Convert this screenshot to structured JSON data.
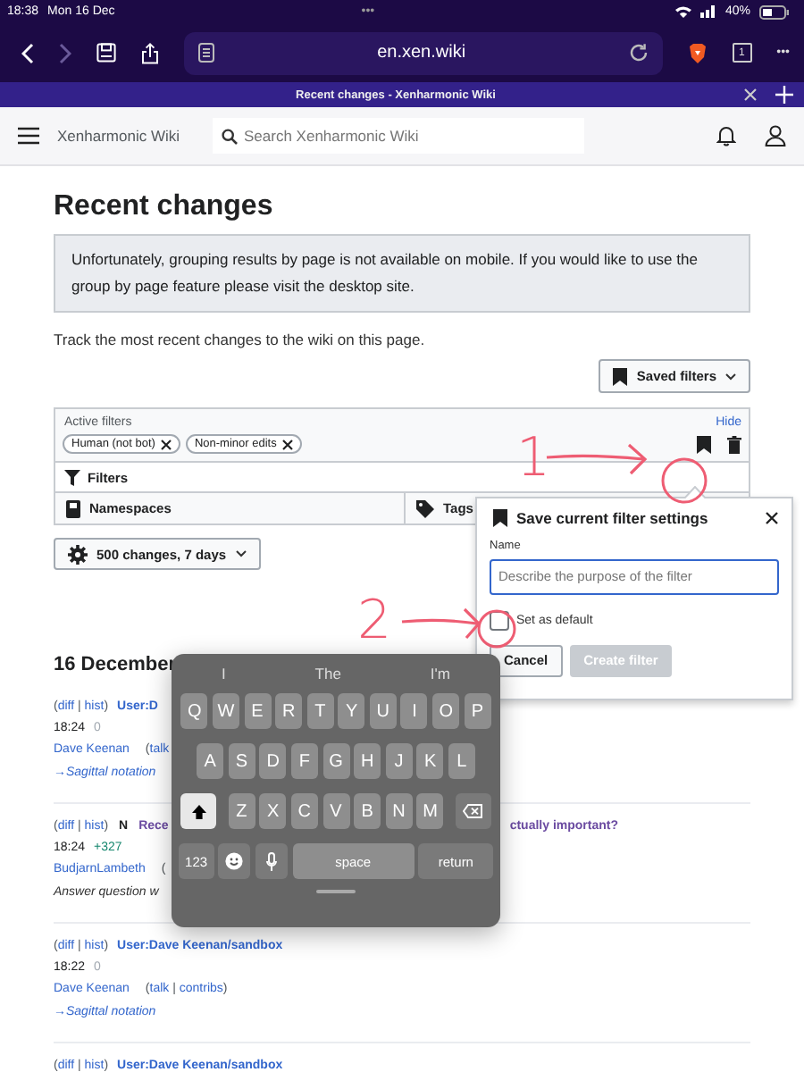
{
  "status_bar": {
    "time": "18:38",
    "date": "Mon 16 Dec",
    "dots": "•••",
    "battery": "40%"
  },
  "browser": {
    "url": "en.xen.wiki",
    "tab_count": "1",
    "more": "•••",
    "tab_title": "Recent changes - Xenharmonic Wiki"
  },
  "wiki_header": {
    "site_name": "Xenharmonic Wiki",
    "search": {
      "placeholder": "Search Xenharmonic Wiki"
    }
  },
  "page": {
    "title": "Recent changes",
    "notice": "Unfortunately, grouping results by page is not available on mobile. If you would like to use the group by page feature please visit the desktop site.",
    "intro": "Track the most recent changes to the wiki on this page.",
    "saved_filters": "Saved filters"
  },
  "active_filters": {
    "label": "Active filters",
    "hide": "Hide",
    "tags": [
      {
        "label": "Human (not bot)"
      },
      {
        "label": "Non-minor edits"
      }
    ]
  },
  "filters": {
    "label": "Filters",
    "menus": [
      {
        "label": "Namespaces",
        "kind": "namespaces"
      },
      {
        "label": "Tags",
        "kind": "tags"
      }
    ]
  },
  "limit_button": "500 changes, 7 days",
  "save_dialog": {
    "title": "Save current filter settings",
    "name_label": "Name",
    "placeholder": "Describe the purpose of the filter",
    "default_label": "Set as default",
    "default_checked": false,
    "cancel": "Cancel",
    "create": "Create filter",
    "create_disabled": true
  },
  "changes": {
    "date": "16 December",
    "entries": [
      {
        "history": [
          {
            "text": "(",
            "kind": "text"
          },
          {
            "text": "diff",
            "kind": "link"
          },
          {
            "text": " | ",
            "kind": "text"
          },
          {
            "text": "hist",
            "kind": "link"
          },
          {
            "text": ")",
            "kind": "text"
          }
        ],
        "title": "User:D",
        "visited": false,
        "time": "18:24",
        "size": {
          "text": "0",
          "kind": "neutral"
        },
        "user": "Dave Keenan",
        "tools": [
          {
            "text": "(",
            "kind": "text"
          },
          {
            "text": "talk",
            "kind": "link"
          }
        ],
        "summary": {
          "text": "→Sagittal notation",
          "kind": "section"
        }
      },
      {
        "history": [
          {
            "text": "(",
            "kind": "text"
          },
          {
            "text": "diff",
            "kind": "link"
          },
          {
            "text": " | ",
            "kind": "text"
          },
          {
            "text": "hist",
            "kind": "link"
          },
          {
            "text": ")",
            "kind": "text"
          }
        ],
        "new_flag": "N",
        "title": "Rece",
        "title_rest": "ctually important?",
        "visited": true,
        "time": "18:24",
        "size": {
          "text": "+327",
          "kind": "positive"
        },
        "user": "BudjarnLambeth",
        "tools": [
          {
            "text": "(",
            "kind": "text"
          }
        ],
        "summary": {
          "text": "Answer question w",
          "kind": "comment"
        }
      },
      {
        "history": [
          {
            "text": "(",
            "kind": "text"
          },
          {
            "text": "diff",
            "kind": "link"
          },
          {
            "text": " | ",
            "kind": "text"
          },
          {
            "text": "hist",
            "kind": "link"
          },
          {
            "text": ")",
            "kind": "text"
          }
        ],
        "title": "User:Dave Keenan/sandbox",
        "visited": false,
        "time": "18:22",
        "size": {
          "text": "0",
          "kind": "neutral"
        },
        "user": "Dave Keenan",
        "tools": [
          {
            "text": "(",
            "kind": "text"
          },
          {
            "text": "talk",
            "kind": "link"
          },
          {
            "text": " | ",
            "kind": "text"
          },
          {
            "text": "contribs",
            "kind": "link"
          },
          {
            "text": ")",
            "kind": "text"
          }
        ],
        "summary": {
          "text": "→Sagittal notation",
          "kind": "section"
        }
      },
      {
        "history": [
          {
            "text": "(",
            "kind": "text"
          },
          {
            "text": "diff",
            "kind": "link"
          },
          {
            "text": " | ",
            "kind": "text"
          },
          {
            "text": "hist",
            "kind": "link"
          },
          {
            "text": ")",
            "kind": "text"
          }
        ],
        "title": "User:Dave Keenan/sandbox",
        "visited": false
      }
    ]
  },
  "keyboard": {
    "suggestions": [
      "I",
      "The",
      "I'm"
    ],
    "letter_rows": [
      [
        "Q",
        "W",
        "E",
        "R",
        "T",
        "Y",
        "U",
        "I",
        "O",
        "P"
      ],
      [
        "A",
        "S",
        "D",
        "F",
        "G",
        "H",
        "J",
        "K",
        "L"
      ],
      [
        "Z",
        "X",
        "C",
        "V",
        "B",
        "N",
        "M"
      ]
    ],
    "numbers_key": "123",
    "space_key": "space",
    "return_key": "return"
  },
  "annotations": [
    {
      "label": "1"
    },
    {
      "label": "2"
    }
  ]
}
